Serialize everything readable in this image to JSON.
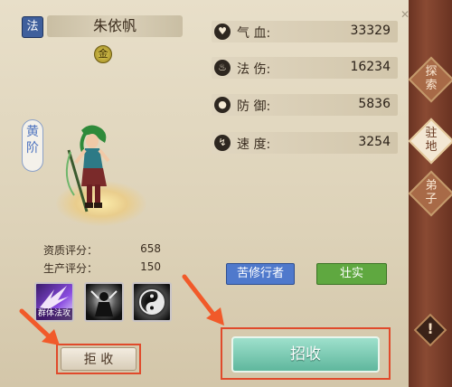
{
  "character": {
    "school": "法",
    "name": "朱依帆",
    "grade_badge": "金",
    "rank": "黄\n阶"
  },
  "stats": {
    "aptitude_label": "资质评分：",
    "aptitude_value": "658",
    "production_label": "生产评分：",
    "production_value": "150"
  },
  "skills": [
    {
      "label": "群体法攻",
      "icon": "group-magic-attack-icon"
    },
    {
      "label": "",
      "icon": "figure-silhouette-icon"
    },
    {
      "label": "",
      "icon": "yin-yang-icon"
    }
  ],
  "buttons": {
    "reject": "拒 收",
    "recruit": "招收"
  },
  "attributes": [
    {
      "name": "气 血:",
      "value": "33329",
      "icon": "heart-icon"
    },
    {
      "name": "法 伤:",
      "value": "16234",
      "icon": "flame-icon"
    },
    {
      "name": "防 御:",
      "value": "5836",
      "icon": "shield-icon"
    },
    {
      "name": "速 度:",
      "value": "3254",
      "icon": "lightning-icon"
    }
  ],
  "traits": [
    "苦修行者",
    "壮实"
  ],
  "sidebar_tabs": [
    "探\n索",
    "驻\n地",
    "弟\n子"
  ],
  "colors": {
    "accent_red": "#e04a2b",
    "recruit_green": "#5fb79d",
    "trait_blue": "#4f79cc",
    "trait_green": "#5fa840",
    "sidebar_brown": "#8a4a33"
  }
}
